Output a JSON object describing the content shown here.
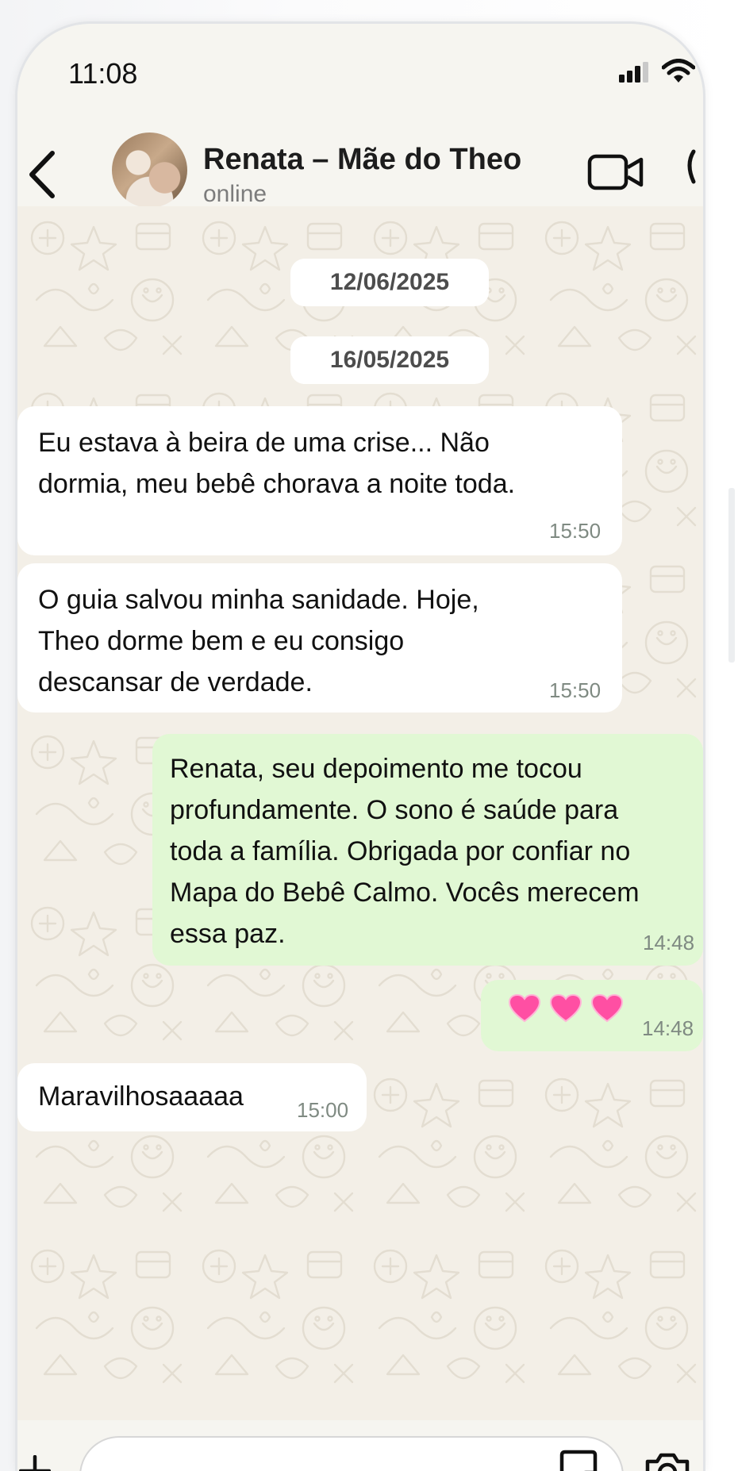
{
  "status_bar": {
    "time": "11:08"
  },
  "header": {
    "contact_name": "Renata – Mãe do Theo",
    "contact_status": "online"
  },
  "chat": {
    "date_chips": [
      "12/06/2025",
      "16/05/2025"
    ],
    "messages": [
      {
        "direction": "incoming",
        "lines": [
          "Eu estava à beira de uma crise... Não",
          "dormia, meu bebê chorava a noite toda."
        ],
        "time": "15:50"
      },
      {
        "direction": "incoming",
        "lines": [
          "O guia salvou minha sanidade. Hoje,",
          "Theo dorme bem e eu consigo",
          "descansar de verdade."
        ],
        "time": "15:50"
      },
      {
        "direction": "outgoing",
        "lines": [
          "Renata, seu depoimento me tocou",
          "profundamente. O sono é saúde para",
          "toda a família. Obrigada por confiar no",
          "Mapa do Bebê Calmo. Vocês merecem",
          "essa paz."
        ],
        "time": "14:48"
      },
      {
        "direction": "outgoing",
        "emoji": "💗💗💗",
        "time": "14:48"
      },
      {
        "direction": "incoming",
        "lines": [
          "Maravilhosaaaaa"
        ],
        "time": "15:00"
      }
    ]
  },
  "colors": {
    "incoming_bubble": "#ffffff",
    "outgoing_bubble": "#e1f8d4",
    "chat_background": "#f3efe7",
    "heart": "#ff4fa3"
  },
  "icons": [
    "back-icon",
    "signal-icon",
    "wifi-icon",
    "video-call-icon",
    "phone-call-icon",
    "plus-icon",
    "sticker-icon",
    "camera-icon",
    "heart-icon"
  ]
}
